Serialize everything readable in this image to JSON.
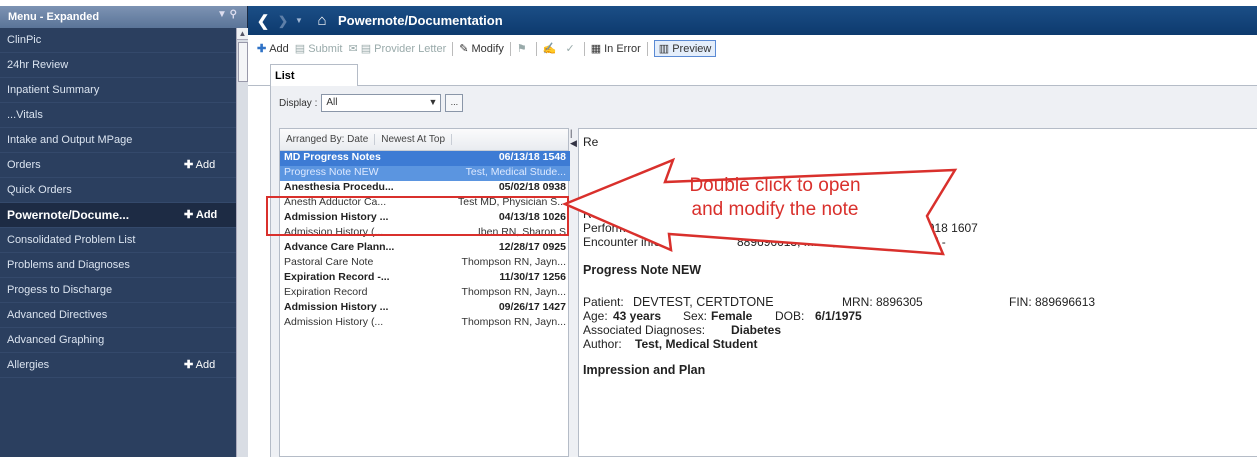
{
  "sidebar": {
    "header": "Menu - Expanded",
    "items": [
      {
        "label": "ClinPic"
      },
      {
        "label": "24hr Review"
      },
      {
        "label": "Inpatient Summary"
      },
      {
        "label": "...Vitals"
      },
      {
        "label": "Intake and Output MPage"
      },
      {
        "label": "Orders",
        "add": "Add"
      },
      {
        "label": "Quick Orders"
      },
      {
        "label": "Powernote/Docume...",
        "add": "Add",
        "active": true
      },
      {
        "label": "Consolidated Problem List"
      },
      {
        "label": "Problems and Diagnoses"
      },
      {
        "label": "Progess to Discharge"
      },
      {
        "label": "Advanced Directives"
      },
      {
        "label": "Advanced Graphing"
      },
      {
        "label": "Allergies",
        "add": "Add"
      }
    ]
  },
  "titlebar": {
    "title": "Powernote/Documentation"
  },
  "toolbar": {
    "add": "Add",
    "submit": "Submit",
    "provider_letter": "Provider Letter",
    "modify": "Modify",
    "in_error": "In Error",
    "preview": "Preview"
  },
  "tabs": {
    "list": "List"
  },
  "display": {
    "label": "Display :",
    "value": "All",
    "more": "..."
  },
  "list": {
    "headers": [
      "Arranged By: Date",
      "Newest At Top"
    ],
    "rows": [
      {
        "left": "MD Progress Notes",
        "right": "06/13/18 1548",
        "bold": true,
        "selected": true
      },
      {
        "left": "Progress Note NEW",
        "right": "Test, Medical Stude...",
        "selected2": true
      },
      {
        "left": "Anesthesia Procedu...",
        "right": "05/02/18 0938",
        "bold": true
      },
      {
        "left": "Anesth Adductor Ca...",
        "right": "Test MD, Physician S..."
      },
      {
        "left": "Admission History ...",
        "right": "04/13/18 1026",
        "bold": true
      },
      {
        "left": "Admission History (...",
        "right": "Iben RN, Sharon S"
      },
      {
        "left": "Advance Care Plann...",
        "right": "12/28/17 0925",
        "bold": true
      },
      {
        "left": "Pastoral Care Note",
        "right": "Thompson RN, Jayn..."
      },
      {
        "left": "Expiration Record -...",
        "right": "11/30/17 1256",
        "bold": true
      },
      {
        "left": "Expiration Record",
        "right": "Thompson RN, Jayn..."
      },
      {
        "left": "Admission History ...",
        "right": "09/26/17 1427",
        "bold": true
      },
      {
        "left": "Admission History (...",
        "right": "Thompson RN, Jayn..."
      }
    ]
  },
  "preview_pane": {
    "re_partial": "Re",
    "res_partial": "Res",
    "performed_by_label": "Performed by:",
    "performed_by_value": "Test, Medical Student on June 13, 2018 1607",
    "encounter_label": "Encounter info:",
    "encounter_value": "889696613, MMC, Inpatient, 7/7/2017 -",
    "heading": "Progress Note NEW",
    "patient_label": "Patient:",
    "patient_value": "DEVTEST, CERTDTONE",
    "mrn": "MRN: 8896305",
    "fin": "FIN: 889696613",
    "age_label": "Age:",
    "age_value": "43 years",
    "sex_label": "Sex:",
    "sex_value": "Female",
    "dob_label": "DOB:",
    "dob_value": "6/1/1975",
    "assoc_label": "Associated Diagnoses:",
    "assoc_value": "Diabetes",
    "author_label": "Author:",
    "author_value": "Test, Medical Student",
    "impression": "Impression and Plan"
  },
  "annotation": {
    "line1": "Double click to open",
    "line2": "and modify the note",
    "color": "#d9302c"
  }
}
